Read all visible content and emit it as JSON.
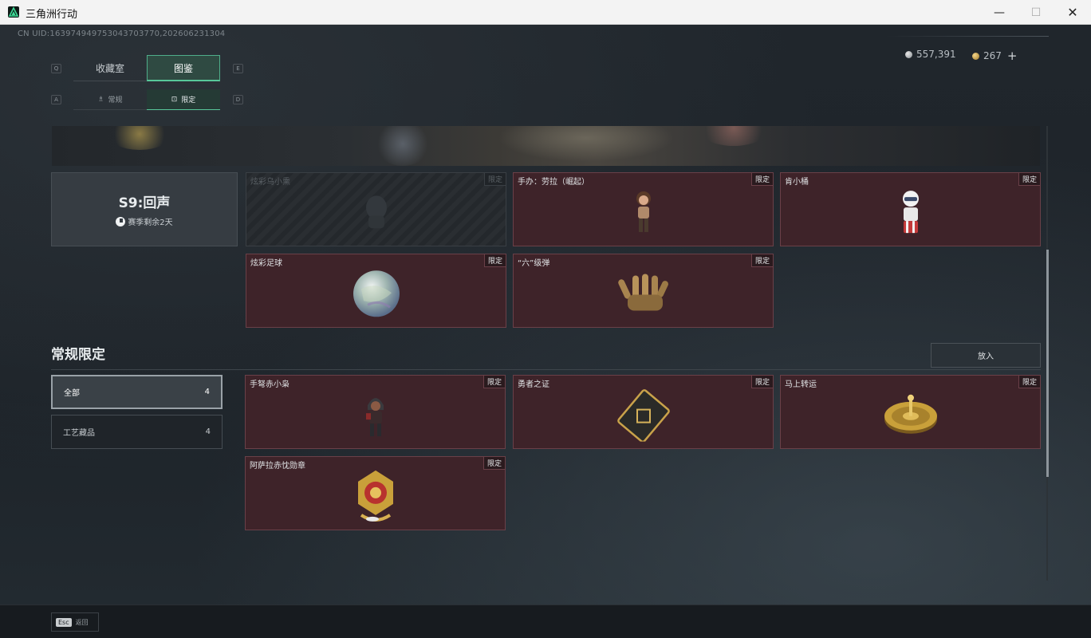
{
  "window": {
    "title": "三角洲行动",
    "minimize": "—",
    "maximize": "☐",
    "close": "✕"
  },
  "header": {
    "uid": "CN UID:16397494975304370377​0,202606231304",
    "silver_amount": "557,391",
    "gold_amount": "267",
    "add_label": "+"
  },
  "tabs": {
    "left_key": "Q",
    "right_key": "E",
    "items": [
      {
        "label": "收藏室"
      },
      {
        "label": "图鉴"
      }
    ]
  },
  "subtabs": {
    "left_key": "A",
    "right_key": "D",
    "items": [
      {
        "label": "常规"
      },
      {
        "label": "限定"
      }
    ]
  },
  "season": {
    "title": "S9:回声",
    "remaining": "赛季剩余2天"
  },
  "tag_label": "限定",
  "season_cards": [
    {
      "name": "炫彩乌小熏",
      "tag": "限定",
      "locked": true
    },
    {
      "name": "手办：劳拉（崛起）",
      "tag": "限定",
      "locked": false
    },
    {
      "name": "肯小桶",
      "tag": "限定",
      "locked": false
    },
    {
      "name": "炫彩足球",
      "tag": "限定",
      "locked": false
    },
    {
      "name": "“六”级弹",
      "tag": "限定",
      "locked": false
    }
  ],
  "section": {
    "title": "常规限定",
    "put_button": "放入"
  },
  "filters": [
    {
      "label": "全部",
      "count": "4"
    },
    {
      "label": "工艺藏品",
      "count": "4"
    }
  ],
  "regular_cards": [
    {
      "name": "手弩赤小枭",
      "tag": "限定"
    },
    {
      "name": "勇者之证",
      "tag": "限定"
    },
    {
      "name": "马上转运",
      "tag": "限定"
    },
    {
      "name": "阿萨拉赤忱勋章",
      "tag": "限定"
    }
  ],
  "footer": {
    "esc_key": "Esc",
    "back_label": "返回"
  },
  "colors": {
    "accent": "#58c79a",
    "card_bg": "#3e2329",
    "card_border": "#6a4048"
  }
}
